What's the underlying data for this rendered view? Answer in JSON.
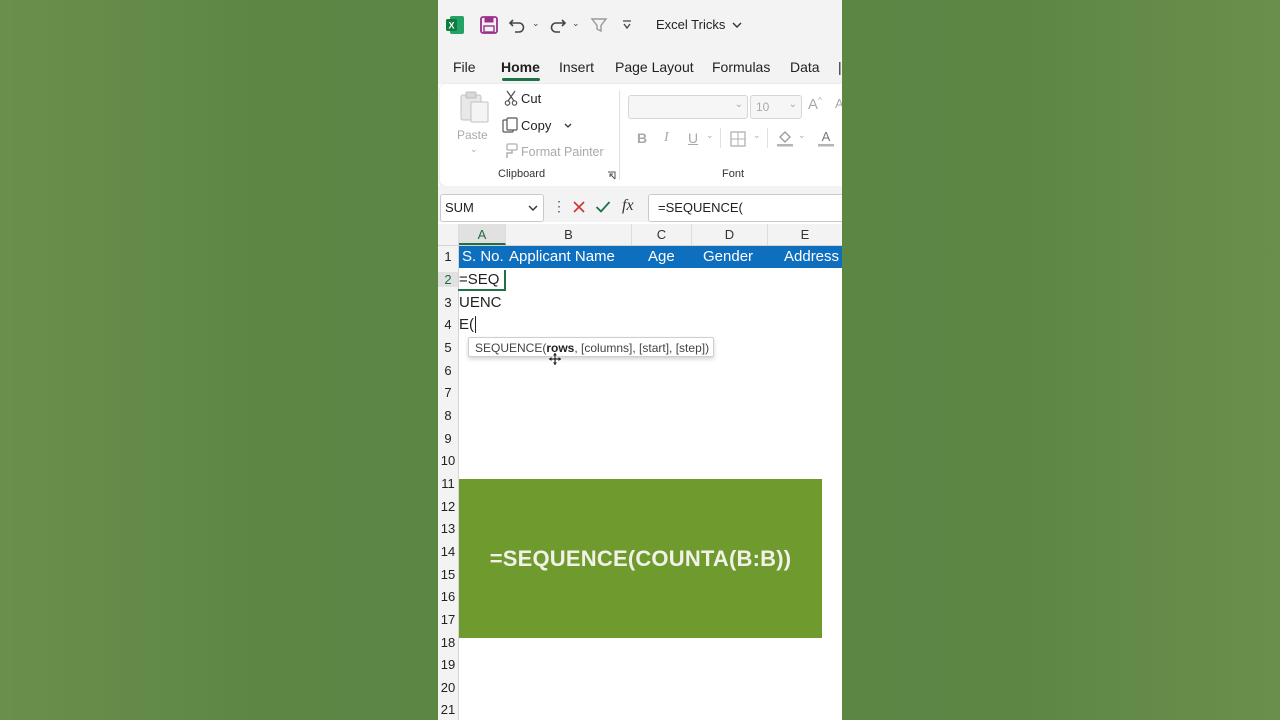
{
  "app": {
    "title": "Excel Tricks",
    "accent": "#1e7145"
  },
  "tabs": [
    "File",
    "Home",
    "Insert",
    "Page Layout",
    "Formulas",
    "Data"
  ],
  "active_tab": "Home",
  "clipboard": {
    "paste": "Paste",
    "cut": "Cut",
    "copy": "Copy",
    "format_painter": "Format Painter",
    "group_label": "Clipboard"
  },
  "font": {
    "size": "10",
    "bold": "B",
    "italic": "I",
    "underline": "U",
    "group_label": "Font"
  },
  "formula_bar": {
    "name_box": "SUM",
    "formula": "=SEQUENCE("
  },
  "columns": [
    "A",
    "B",
    "C",
    "D",
    "E"
  ],
  "rows": [
    "1",
    "2",
    "3",
    "4",
    "5",
    "6",
    "7",
    "8",
    "9",
    "10",
    "11",
    "12",
    "13",
    "14",
    "15",
    "16",
    "17",
    "18",
    "19",
    "20",
    "21"
  ],
  "header_row": {
    "a": "S. No.",
    "b": "Applicant Name",
    "c": "Age",
    "d": "Gender",
    "e": "Address",
    "fill": "#0f6fbf"
  },
  "cells": {
    "a2": "=SEQ",
    "a3": "UENC",
    "a4": "E("
  },
  "tooltip": {
    "prefix": "SEQUENCE(",
    "bold_arg": "rows",
    "rest": ", [columns], [start], [step])"
  },
  "banner": {
    "text": "=SEQUENCE(COUNTA(B:B))",
    "color": "#6f9a2e"
  }
}
